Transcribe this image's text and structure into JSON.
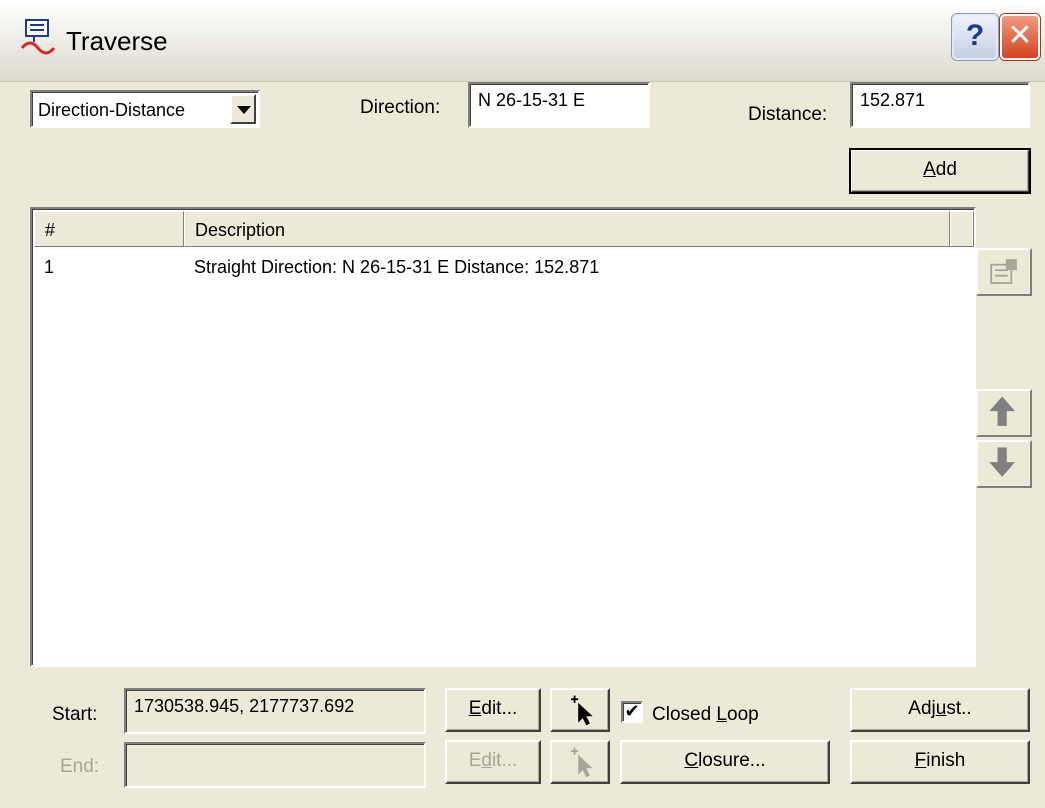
{
  "window": {
    "title": "Traverse",
    "help": "?",
    "close": "✕"
  },
  "input_mode": {
    "selected": "Direction-Distance"
  },
  "direction": {
    "label": "Direction:",
    "value": "N 26-15-31 E"
  },
  "distance": {
    "label": "Distance:",
    "value": "152.871"
  },
  "add_button": {
    "label_pre": "",
    "label_accel": "A",
    "label_post": "dd"
  },
  "list": {
    "columns": [
      "#",
      "Description"
    ],
    "rows": [
      {
        "num": "1",
        "description": "Straight  Direction: N 26-15-31 E  Distance: 152.871"
      }
    ]
  },
  "side_buttons": {
    "properties_icon": "properties-icon",
    "up_icon": "arrow-up-icon",
    "down_icon": "arrow-down-icon"
  },
  "start": {
    "label": "Start:",
    "value": "1730538.945,  2177737.692"
  },
  "end": {
    "label": "End:",
    "value": ""
  },
  "edit_start": {
    "label_pre": "",
    "label_accel": "E",
    "label_post": "dit..."
  },
  "edit_end": {
    "label_pre": "E",
    "label_accel": "d",
    "label_post": "it..."
  },
  "closed_loop": {
    "label_pre": "Closed ",
    "label_accel": "L",
    "label_post": "oop",
    "checked": true
  },
  "adjust_button": {
    "label_pre": "Adj",
    "label_accel": "u",
    "label_post": "st.."
  },
  "closure_button": {
    "label_pre": "",
    "label_accel": "C",
    "label_post": "losure..."
  },
  "finish_button": {
    "label_pre": "",
    "label_accel": "F",
    "label_post": "inish"
  },
  "colors": {
    "titlebar": "#f1f0ea",
    "close": "#d44320",
    "dialog": "#ece9d8"
  }
}
